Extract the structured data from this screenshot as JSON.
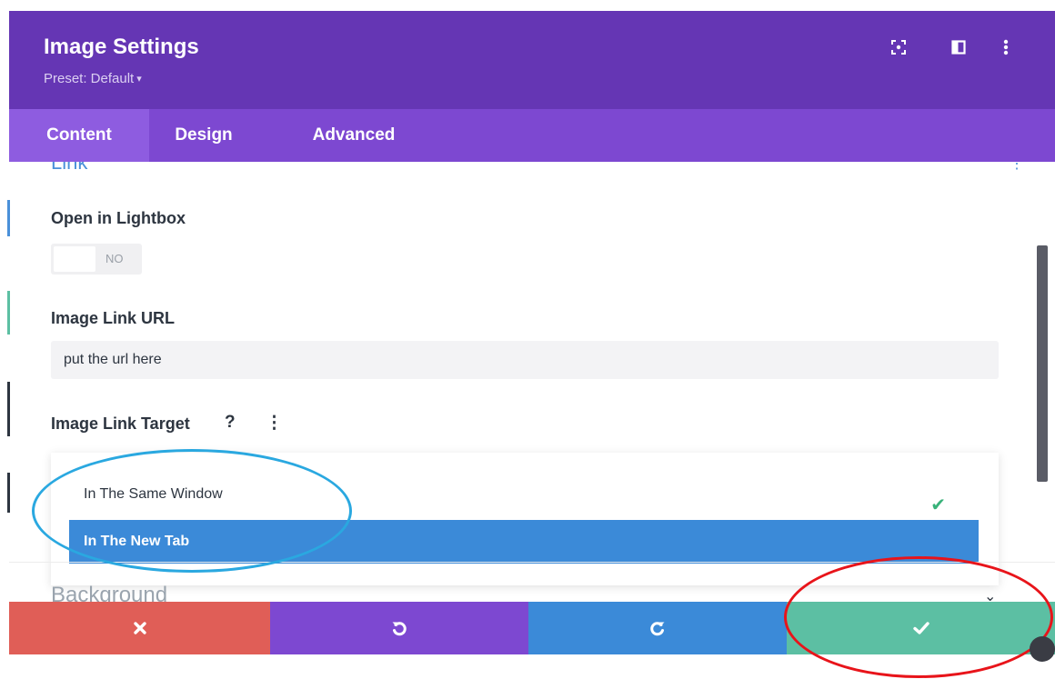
{
  "header": {
    "title": "Image Settings",
    "preset": "Preset: Default",
    "icons": [
      "focus-icon",
      "split-view-icon",
      "more-options-icon"
    ]
  },
  "tabs": [
    {
      "label": "Content",
      "active": true
    },
    {
      "label": "Design",
      "active": false
    },
    {
      "label": "Advanced",
      "active": false
    }
  ],
  "section": {
    "title": "Link"
  },
  "lightbox": {
    "label": "Open in Lightbox",
    "toggle_text": "NO"
  },
  "link_url": {
    "label": "Image Link URL",
    "value": "put the url here"
  },
  "link_target": {
    "label": "Image Link Target",
    "help": "?",
    "options": [
      {
        "label": "In The Same Window",
        "checked": true,
        "highlighted": false
      },
      {
        "label": "In The New Tab",
        "checked": false,
        "highlighted": true
      }
    ]
  },
  "background": {
    "title": "Background"
  },
  "footer": {
    "buttons": [
      "discard",
      "undo",
      "redo",
      "save"
    ]
  },
  "colors": {
    "header": "#6536b4",
    "tabs": "#7d48d1",
    "discard": "#e05e57",
    "undo": "#7d48d1",
    "redo": "#3b8ad8",
    "save": "#5cbfa3",
    "highlight": "#3b8ad8",
    "annotation_blue": "#2aa8e0",
    "annotation_red": "#e8141a"
  }
}
